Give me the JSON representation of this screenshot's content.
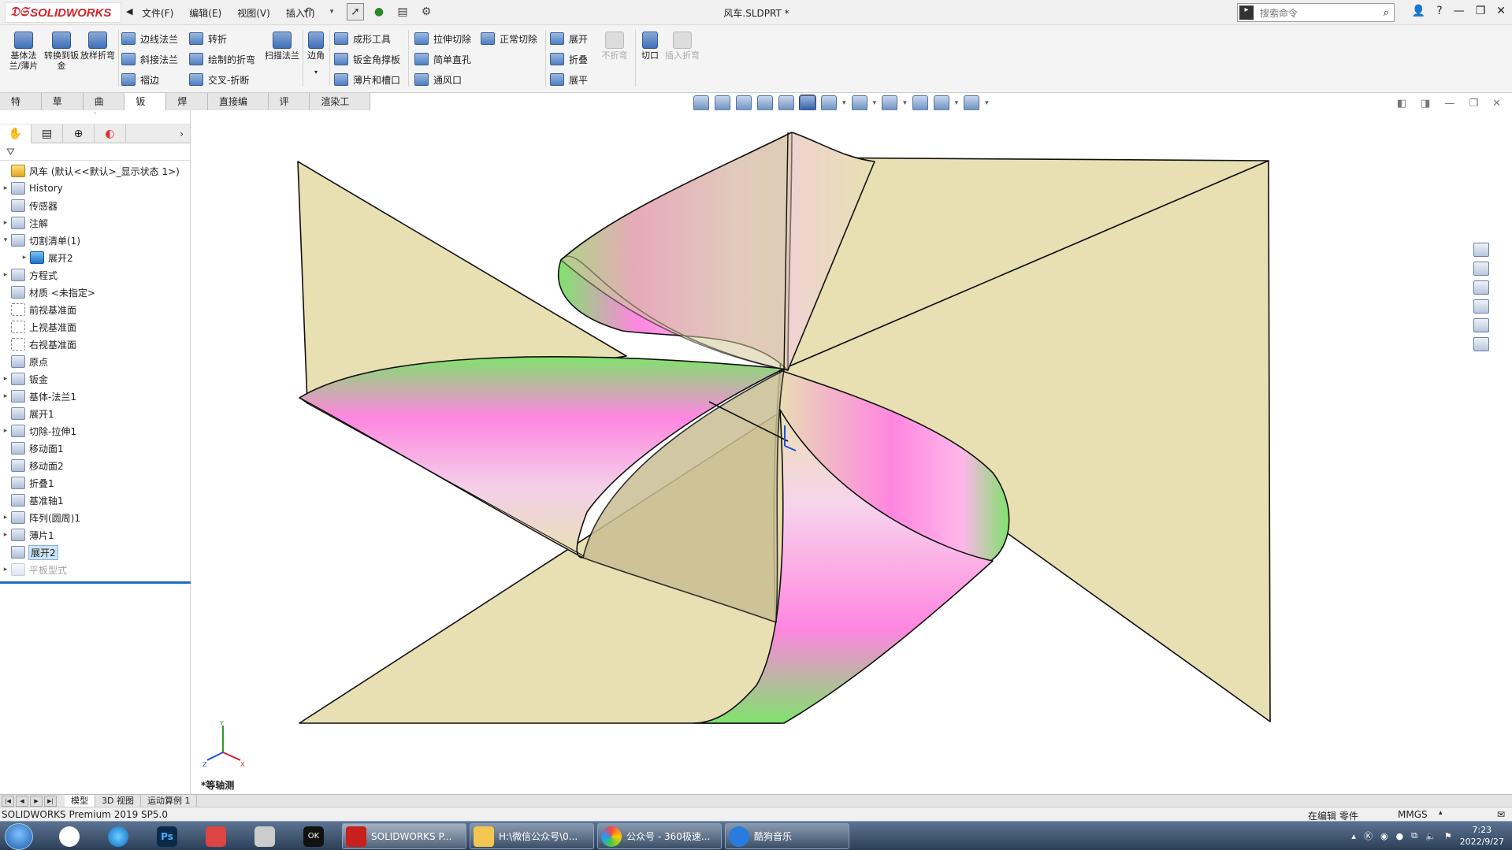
{
  "title_bar": {
    "brand": "SOLIDWORKS",
    "menus": [
      "文件(F)",
      "编辑(E)",
      "视图(V)",
      "插入(I)"
    ],
    "doc_title": "风车.SLDPRT *",
    "search_placeholder": "搜索命令"
  },
  "ribbon": {
    "big_buttons": [
      {
        "label": "基体法兰/薄片"
      },
      {
        "label": "转换到钣金"
      },
      {
        "label": "放样折弯"
      }
    ],
    "col1": [
      "边线法兰",
      "斜接法兰",
      "褶边"
    ],
    "col2": [
      "转折",
      "绘制的折弯",
      "交叉-折断"
    ],
    "sweep": "扫描法兰",
    "corner": "边角",
    "col3": [
      "成形工具",
      "钣金角撑板",
      "薄片和槽口"
    ],
    "col4": [
      "拉伸切除",
      "简单直孔",
      "通风口"
    ],
    "normal_cut": "正常切除",
    "col5": [
      "展开",
      "折叠",
      "展平"
    ],
    "no_bend": "不折弯",
    "rip": "切口",
    "insert_bends": "插入折弯"
  },
  "tabs": [
    "特征",
    "草图",
    "曲面",
    "钣金",
    "焊件",
    "直接编辑",
    "评估",
    "渲染工具"
  ],
  "active_tab": "钣金",
  "tree": {
    "root": "风车  (默认<<默认>_显示状态 1>)",
    "items": [
      {
        "label": "History",
        "arrow": "▸",
        "icon": "history-icon"
      },
      {
        "label": "传感器",
        "arrow": "",
        "icon": "sensor-icon"
      },
      {
        "label": "注解",
        "arrow": "▸",
        "icon": "annotation-icon"
      },
      {
        "label": "切割清单(1)",
        "arrow": "▾",
        "icon": "cutlist-icon"
      },
      {
        "label": "展开2",
        "arrow": "▸",
        "icon": "body-icon",
        "child": true
      },
      {
        "label": "方程式",
        "arrow": "▸",
        "icon": "equation-icon"
      },
      {
        "label": "材质 <未指定>",
        "arrow": "",
        "icon": "material-icon"
      },
      {
        "label": "前视基准面",
        "arrow": "",
        "icon": "plane-icon"
      },
      {
        "label": "上视基准面",
        "arrow": "",
        "icon": "plane-icon"
      },
      {
        "label": "右视基准面",
        "arrow": "",
        "icon": "plane-icon"
      },
      {
        "label": "原点",
        "arrow": "",
        "icon": "origin-icon"
      },
      {
        "label": "钣金",
        "arrow": "▸",
        "icon": "sheetmetal-icon"
      },
      {
        "label": "基体-法兰1",
        "arrow": "▸",
        "icon": "base-flange-icon"
      },
      {
        "label": "展开1",
        "arrow": "",
        "icon": "unfold-icon"
      },
      {
        "label": "切除-拉伸1",
        "arrow": "▸",
        "icon": "cut-extrude-icon"
      },
      {
        "label": "移动面1",
        "arrow": "",
        "icon": "move-face-icon"
      },
      {
        "label": "移动面2",
        "arrow": "",
        "icon": "move-face-icon"
      },
      {
        "label": "折叠1",
        "arrow": "",
        "icon": "fold-icon"
      },
      {
        "label": "基准轴1",
        "arrow": "",
        "icon": "axis-icon"
      },
      {
        "label": "阵列(圆周)1",
        "arrow": "▸",
        "icon": "circular-pattern-icon"
      },
      {
        "label": "薄片1",
        "arrow": "▸",
        "icon": "tab-icon"
      },
      {
        "label": "展开2",
        "arrow": "",
        "icon": "unfold-icon",
        "selected": true
      },
      {
        "label": "平板型式",
        "arrow": "▸",
        "icon": "flat-pattern-icon",
        "greyed": true
      }
    ]
  },
  "viewport": {
    "view_label": "*等轴测",
    "colors": {
      "face": "#e8e0b2",
      "magenta": "#ff88dd",
      "green": "#7fe26c"
    }
  },
  "bottom_tabs": [
    "模型",
    "3D 视图",
    "运动算例 1"
  ],
  "status": {
    "left": "SOLIDWORKS Premium 2019 SP5.0",
    "mode": "在编辑 零件",
    "units": "MMGS"
  },
  "taskbar": {
    "windows": [
      "SOLIDWORKS P...",
      "H:\\微信公众号\\0...",
      "公众号 - 360极速...",
      "酷狗音乐"
    ],
    "time": "7:23",
    "date": "2022/9/27"
  }
}
